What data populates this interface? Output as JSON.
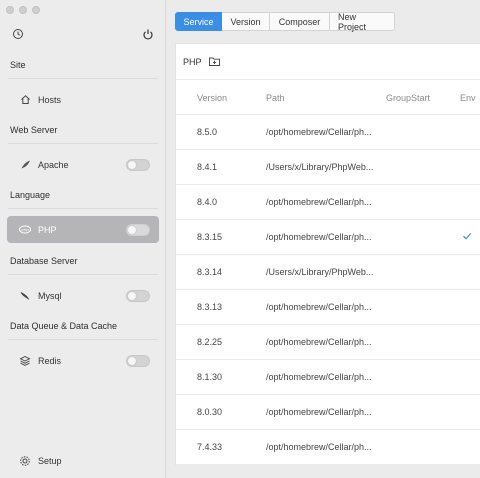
{
  "sidebar": {
    "sections": [
      {
        "title": "Site",
        "items": [
          {
            "label": "Hosts",
            "icon": "home-icon",
            "toggle": false
          }
        ]
      },
      {
        "title": "Web Server",
        "items": [
          {
            "label": "Apache",
            "icon": "feather-icon",
            "toggle": true,
            "enabled": false
          }
        ]
      },
      {
        "title": "Language",
        "items": [
          {
            "label": "PHP",
            "icon": "php-icon",
            "toggle": true,
            "enabled": false,
            "active": true
          }
        ]
      },
      {
        "title": "Database Server",
        "items": [
          {
            "label": "Mysql",
            "icon": "dolphin-icon",
            "toggle": true,
            "enabled": false
          }
        ]
      },
      {
        "title": "Data Queue & Data Cache",
        "items": [
          {
            "label": "Redis",
            "icon": "layers-icon",
            "toggle": true,
            "enabled": false
          }
        ]
      }
    ],
    "footer": {
      "label": "Setup",
      "icon": "gear-icon"
    }
  },
  "tabs": [
    {
      "label": "Service",
      "active": true
    },
    {
      "label": "Version",
      "active": false
    },
    {
      "label": "Composer",
      "active": false
    },
    {
      "label": "New Project",
      "active": false
    }
  ],
  "panel": {
    "title": "PHP",
    "columns": [
      "Version",
      "Path",
      "GroupStart",
      "Env"
    ],
    "rows": [
      {
        "version": "8.5.0",
        "path": "/opt/homebrew/Cellar/ph...",
        "env": false
      },
      {
        "version": "8.4.1",
        "path": "/Users/x/Library/PhpWeb...",
        "env": false
      },
      {
        "version": "8.4.0",
        "path": "/opt/homebrew/Cellar/ph...",
        "env": false
      },
      {
        "version": "8.3.15",
        "path": "/opt/homebrew/Cellar/ph...",
        "env": true
      },
      {
        "version": "8.3.14",
        "path": "/Users/x/Library/PhpWeb...",
        "env": false
      },
      {
        "version": "8.3.13",
        "path": "/opt/homebrew/Cellar/ph...",
        "env": false
      },
      {
        "version": "8.2.25",
        "path": "/opt/homebrew/Cellar/ph...",
        "env": false
      },
      {
        "version": "8.1.30",
        "path": "/opt/homebrew/Cellar/ph...",
        "env": false
      },
      {
        "version": "8.0.30",
        "path": "/opt/homebrew/Cellar/ph...",
        "env": false
      },
      {
        "version": "7.4.33",
        "path": "/opt/homebrew/Cellar/ph...",
        "env": false
      }
    ]
  },
  "colors": {
    "accent": "#3a8ee6",
    "active_item": "#b5b5b8"
  }
}
